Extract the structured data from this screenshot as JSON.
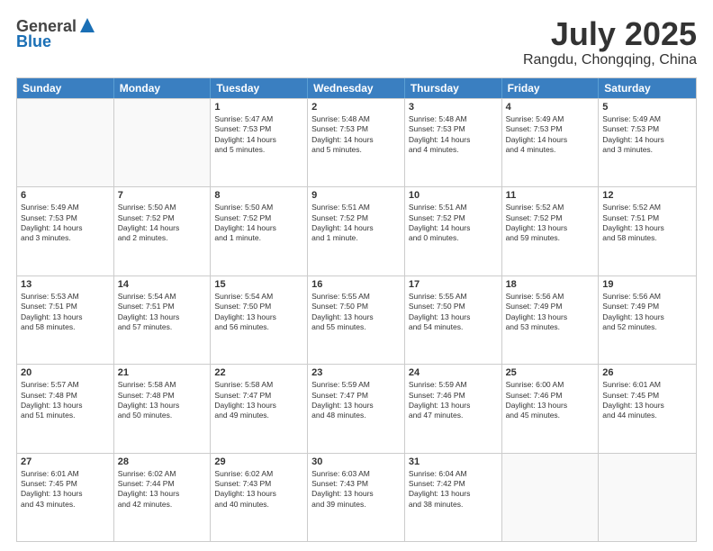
{
  "header": {
    "logo_line1": "General",
    "logo_line2": "Blue",
    "month": "July 2025",
    "location": "Rangdu, Chongqing, China"
  },
  "weekdays": [
    "Sunday",
    "Monday",
    "Tuesday",
    "Wednesday",
    "Thursday",
    "Friday",
    "Saturday"
  ],
  "rows": [
    [
      {
        "day": "",
        "info": ""
      },
      {
        "day": "",
        "info": ""
      },
      {
        "day": "1",
        "info": "Sunrise: 5:47 AM\nSunset: 7:53 PM\nDaylight: 14 hours\nand 5 minutes."
      },
      {
        "day": "2",
        "info": "Sunrise: 5:48 AM\nSunset: 7:53 PM\nDaylight: 14 hours\nand 5 minutes."
      },
      {
        "day": "3",
        "info": "Sunrise: 5:48 AM\nSunset: 7:53 PM\nDaylight: 14 hours\nand 4 minutes."
      },
      {
        "day": "4",
        "info": "Sunrise: 5:49 AM\nSunset: 7:53 PM\nDaylight: 14 hours\nand 4 minutes."
      },
      {
        "day": "5",
        "info": "Sunrise: 5:49 AM\nSunset: 7:53 PM\nDaylight: 14 hours\nand 3 minutes."
      }
    ],
    [
      {
        "day": "6",
        "info": "Sunrise: 5:49 AM\nSunset: 7:53 PM\nDaylight: 14 hours\nand 3 minutes."
      },
      {
        "day": "7",
        "info": "Sunrise: 5:50 AM\nSunset: 7:52 PM\nDaylight: 14 hours\nand 2 minutes."
      },
      {
        "day": "8",
        "info": "Sunrise: 5:50 AM\nSunset: 7:52 PM\nDaylight: 14 hours\nand 1 minute."
      },
      {
        "day": "9",
        "info": "Sunrise: 5:51 AM\nSunset: 7:52 PM\nDaylight: 14 hours\nand 1 minute."
      },
      {
        "day": "10",
        "info": "Sunrise: 5:51 AM\nSunset: 7:52 PM\nDaylight: 14 hours\nand 0 minutes."
      },
      {
        "day": "11",
        "info": "Sunrise: 5:52 AM\nSunset: 7:52 PM\nDaylight: 13 hours\nand 59 minutes."
      },
      {
        "day": "12",
        "info": "Sunrise: 5:52 AM\nSunset: 7:51 PM\nDaylight: 13 hours\nand 58 minutes."
      }
    ],
    [
      {
        "day": "13",
        "info": "Sunrise: 5:53 AM\nSunset: 7:51 PM\nDaylight: 13 hours\nand 58 minutes."
      },
      {
        "day": "14",
        "info": "Sunrise: 5:54 AM\nSunset: 7:51 PM\nDaylight: 13 hours\nand 57 minutes."
      },
      {
        "day": "15",
        "info": "Sunrise: 5:54 AM\nSunset: 7:50 PM\nDaylight: 13 hours\nand 56 minutes."
      },
      {
        "day": "16",
        "info": "Sunrise: 5:55 AM\nSunset: 7:50 PM\nDaylight: 13 hours\nand 55 minutes."
      },
      {
        "day": "17",
        "info": "Sunrise: 5:55 AM\nSunset: 7:50 PM\nDaylight: 13 hours\nand 54 minutes."
      },
      {
        "day": "18",
        "info": "Sunrise: 5:56 AM\nSunset: 7:49 PM\nDaylight: 13 hours\nand 53 minutes."
      },
      {
        "day": "19",
        "info": "Sunrise: 5:56 AM\nSunset: 7:49 PM\nDaylight: 13 hours\nand 52 minutes."
      }
    ],
    [
      {
        "day": "20",
        "info": "Sunrise: 5:57 AM\nSunset: 7:48 PM\nDaylight: 13 hours\nand 51 minutes."
      },
      {
        "day": "21",
        "info": "Sunrise: 5:58 AM\nSunset: 7:48 PM\nDaylight: 13 hours\nand 50 minutes."
      },
      {
        "day": "22",
        "info": "Sunrise: 5:58 AM\nSunset: 7:47 PM\nDaylight: 13 hours\nand 49 minutes."
      },
      {
        "day": "23",
        "info": "Sunrise: 5:59 AM\nSunset: 7:47 PM\nDaylight: 13 hours\nand 48 minutes."
      },
      {
        "day": "24",
        "info": "Sunrise: 5:59 AM\nSunset: 7:46 PM\nDaylight: 13 hours\nand 47 minutes."
      },
      {
        "day": "25",
        "info": "Sunrise: 6:00 AM\nSunset: 7:46 PM\nDaylight: 13 hours\nand 45 minutes."
      },
      {
        "day": "26",
        "info": "Sunrise: 6:01 AM\nSunset: 7:45 PM\nDaylight: 13 hours\nand 44 minutes."
      }
    ],
    [
      {
        "day": "27",
        "info": "Sunrise: 6:01 AM\nSunset: 7:45 PM\nDaylight: 13 hours\nand 43 minutes."
      },
      {
        "day": "28",
        "info": "Sunrise: 6:02 AM\nSunset: 7:44 PM\nDaylight: 13 hours\nand 42 minutes."
      },
      {
        "day": "29",
        "info": "Sunrise: 6:02 AM\nSunset: 7:43 PM\nDaylight: 13 hours\nand 40 minutes."
      },
      {
        "day": "30",
        "info": "Sunrise: 6:03 AM\nSunset: 7:43 PM\nDaylight: 13 hours\nand 39 minutes."
      },
      {
        "day": "31",
        "info": "Sunrise: 6:04 AM\nSunset: 7:42 PM\nDaylight: 13 hours\nand 38 minutes."
      },
      {
        "day": "",
        "info": ""
      },
      {
        "day": "",
        "info": ""
      }
    ]
  ]
}
